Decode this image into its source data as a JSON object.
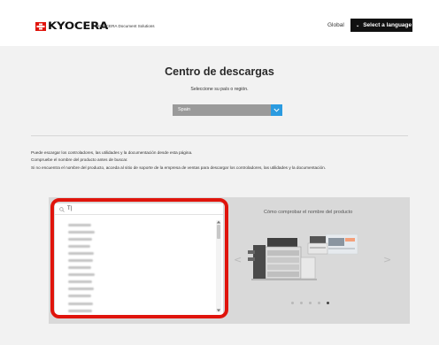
{
  "header": {
    "logo_text": "KYOCERA",
    "brand_subtitle": "KYOCERA Document Solutions",
    "global_link": "Global",
    "language_button": "Select a language",
    "brand_color": "#e0140c"
  },
  "main": {
    "title": "Centro de descargas",
    "subtitle": "Seleccione su país o región.",
    "country_select": {
      "value": "Spain",
      "accent": "#2b9be0"
    },
    "info_lines": [
      "Puede escargar los controladores, las utilidades y la documentación desde esta página.",
      "Compruebe el nombre del producto antes de buscar.",
      "Si no encuentra el nombre del producto, acceda al sitio de soporte de la empresa de ventas para descargar los controladores, las utilidades y la documentación."
    ]
  },
  "search": {
    "value": "T|",
    "highlight_color": "#e0140c",
    "results_obscured": true
  },
  "carousel": {
    "heading": "Cómo comprobar el nombre del producto",
    "prev_label": "<",
    "next_label": ">",
    "slide_count": 5,
    "active_slide": 5
  }
}
